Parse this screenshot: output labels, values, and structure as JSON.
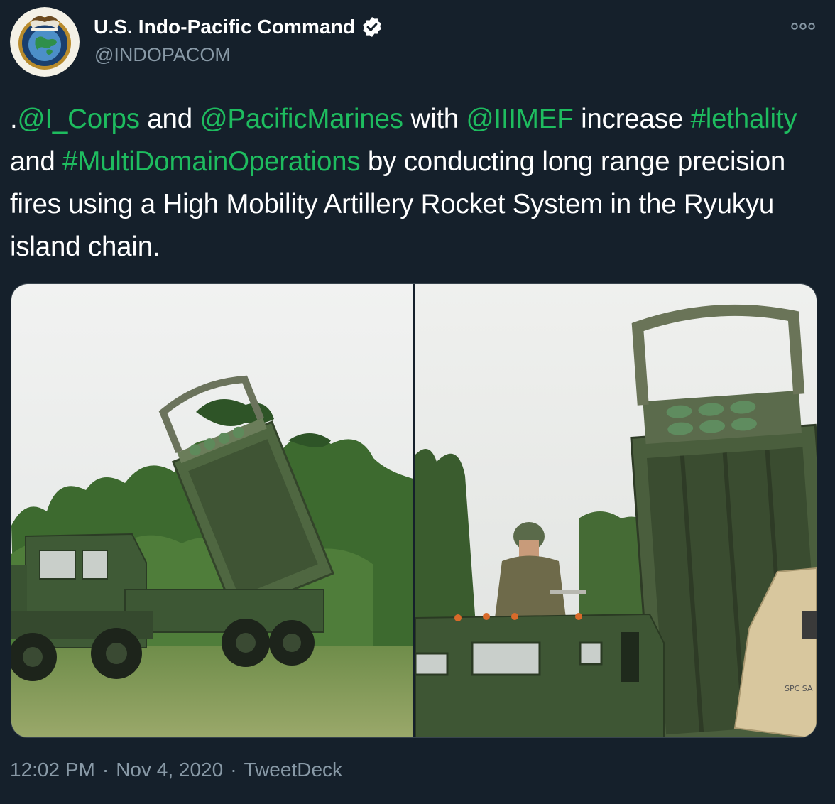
{
  "author": {
    "display_name": "U.S. Indo-Pacific Command",
    "handle": "@INDOPACOM",
    "verified": true,
    "avatar_icon": "indopacom-seal-icon"
  },
  "tweet": {
    "segments": [
      {
        "text": ".",
        "type": "text"
      },
      {
        "text": "@I_Corps",
        "type": "mention"
      },
      {
        "text": " and ",
        "type": "text"
      },
      {
        "text": "@PacificMarines",
        "type": "mention"
      },
      {
        "text": " with ",
        "type": "text"
      },
      {
        "text": "@IIIMEF",
        "type": "mention"
      },
      {
        "text": " increase ",
        "type": "text"
      },
      {
        "text": "#lethality",
        "type": "hashtag"
      },
      {
        "text": " and ",
        "type": "text"
      },
      {
        "text": "#MultiDomainOperations",
        "type": "hashtag"
      },
      {
        "text": " by conducting long range precision fires using a High Mobility Artillery Rocket System in the Ryukyu island chain.",
        "type": "text"
      }
    ],
    "media": [
      {
        "icon": "himars-launcher-wide-photo"
      },
      {
        "icon": "himars-launcher-closeup-photo",
        "vehicle_marking": "SPC SA"
      }
    ],
    "time": "12:02 PM",
    "date": "Nov 4, 2020",
    "separator": "·",
    "source": "TweetDeck"
  },
  "colors": {
    "background": "#15202b",
    "link": "#1ebc5f",
    "secondary_text": "#8899a6",
    "border": "#38444d"
  }
}
